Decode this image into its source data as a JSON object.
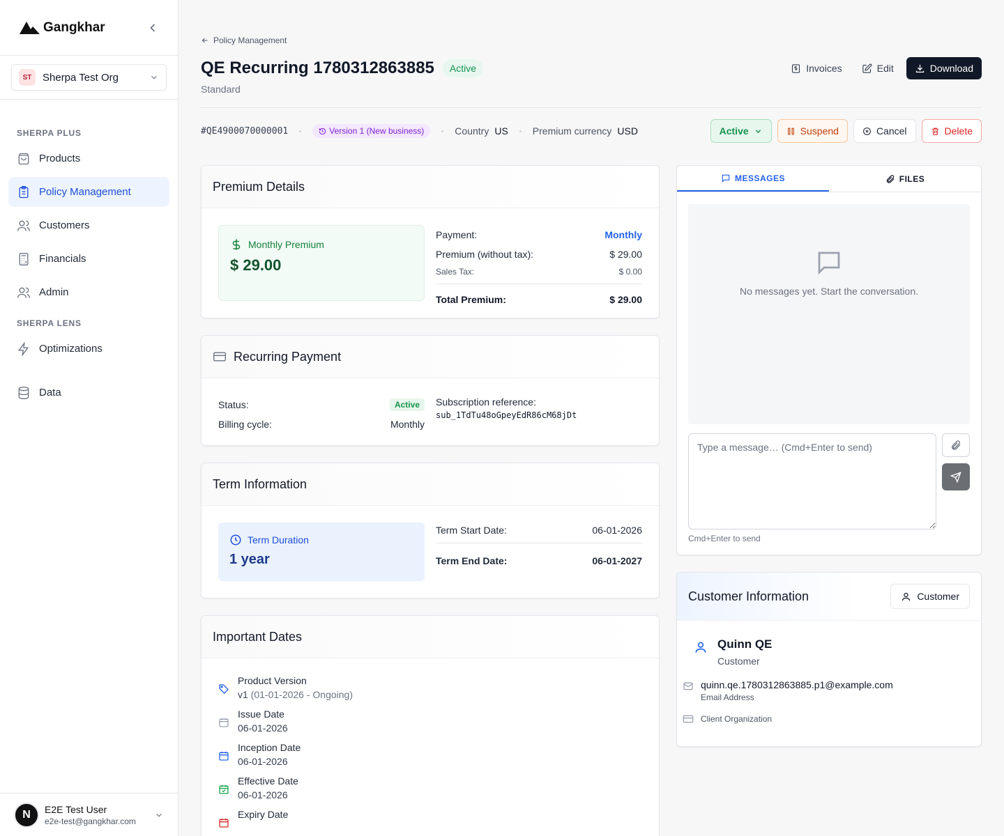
{
  "brand": {
    "name": "Gangkhar"
  },
  "org": {
    "initials": "ST",
    "name": "Sherpa Test Org"
  },
  "nav": {
    "section1": "SHERPA PLUS",
    "items1": [
      {
        "label": "Products"
      },
      {
        "label": "Policy Management"
      },
      {
        "label": "Customers"
      },
      {
        "label": "Financials"
      },
      {
        "label": "Admin"
      }
    ],
    "section2": "SHERPA LENS",
    "items2": [
      {
        "label": "Optimizations"
      }
    ],
    "data_label": "Data"
  },
  "user": {
    "initial": "N",
    "name": "E2E Test User",
    "email": "e2e-test@gangkhar.com"
  },
  "header": {
    "breadcrumb": "Policy Management",
    "title": "QE Recurring 1780312863885",
    "status": "Active",
    "subtitle": "Standard",
    "actions": {
      "invoices": "Invoices",
      "edit": "Edit",
      "download": "Download"
    }
  },
  "meta": {
    "policy_number": "#QE4900070000001",
    "version": "Version 1 (New business)",
    "country_label": "Country",
    "country": "US",
    "currency_label": "Premium currency",
    "currency": "USD"
  },
  "status_actions": {
    "active": "Active",
    "suspend": "Suspend",
    "cancel": "Cancel",
    "delete": "Delete"
  },
  "premium": {
    "title": "Premium Details",
    "box_label": "Monthly Premium",
    "box_amount": "$ 29.00",
    "payment_label": "Payment:",
    "payment_value": "Monthly",
    "premium_label": "Premium (without tax):",
    "premium_value": "$ 29.00",
    "tax_label": "Sales Tax:",
    "tax_value": "$ 0.00",
    "total_label": "Total Premium:",
    "total_value": "$ 29.00"
  },
  "recurring": {
    "title": "Recurring Payment",
    "status_label": "Status:",
    "status_value": "Active",
    "cycle_label": "Billing cycle:",
    "cycle_value": "Monthly",
    "ref_label": "Subscription reference:",
    "ref_value": "sub_1TdTu48oGpeyEdR86cM68jDt"
  },
  "term": {
    "title": "Term Information",
    "box_label": "Term Duration",
    "box_value": "1 year",
    "start_label": "Term Start Date:",
    "start_value": "06-01-2026",
    "end_label": "Term End Date:",
    "end_value": "06-01-2027"
  },
  "dates": {
    "title": "Important Dates",
    "items": [
      {
        "label": "Product Version",
        "value": "v1",
        "extra": " (01-01-2026 - Ongoing)"
      },
      {
        "label": "Issue Date",
        "value": "06-01-2026"
      },
      {
        "label": "Inception Date",
        "value": "06-01-2026"
      },
      {
        "label": "Effective Date",
        "value": "06-01-2026"
      },
      {
        "label": "Expiry Date",
        "value": ""
      }
    ]
  },
  "messages": {
    "tab_messages": "MESSAGES",
    "tab_files": "FILES",
    "empty": "No messages yet. Start the conversation.",
    "placeholder": "Type a message… (Cmd+Enter to send)",
    "hint": "Cmd+Enter to send"
  },
  "customer": {
    "title": "Customer Information",
    "button": "Customer",
    "name": "Quinn QE",
    "role": "Customer",
    "email": "quinn.qe.1780312863885.p1@example.com",
    "email_label": "Email Address",
    "org_label": "Client Organization"
  },
  "colors": {
    "accent": "#2563eb",
    "success": "#15924f",
    "danger": "#dc2626",
    "warning": "#c2410c",
    "dark": "#111827"
  }
}
